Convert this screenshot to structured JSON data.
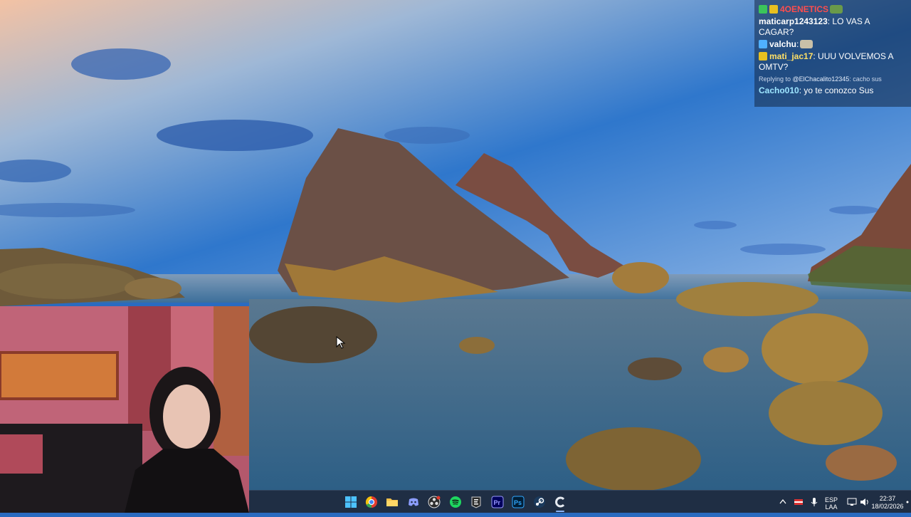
{
  "chat": {
    "messages": [
      {
        "user": "4OENETICS",
        "text": "",
        "user_color": "#ff4d4d",
        "badge_color": "#e8c020"
      },
      {
        "user": "maticarp1243123",
        "text": ": LO VAS A CAGAR?",
        "user_color": "#ffffff"
      },
      {
        "user": "valchu",
        "text": ":",
        "user_color": "#ffffff",
        "badge_color": "#4fb0ff"
      },
      {
        "user": "mati_jac17",
        "text": ": UUU VOLVEMOS A OMTV?",
        "user_color": "#ffe066",
        "badge_color": "#e8c020"
      },
      {
        "reply_prefix": "Replying to",
        "reply_target": "@ElChacalito12345",
        "reply_text": ": cacho sus"
      },
      {
        "user": "Cacho010",
        "text": ": yo te conozco Sus",
        "user_color": "#9ee6ff"
      }
    ]
  },
  "taskbar": {
    "pinned_apps": [
      "windows-start-icon",
      "chrome-icon",
      "file-explorer-icon",
      "discord-icon",
      "obs-icon",
      "spotify-icon",
      "epic-games-icon",
      "premiere-pro-icon",
      "photoshop-icon",
      "steam-icon",
      "app-icon"
    ],
    "tray": {
      "lang": "ESP",
      "layout": "LAA",
      "time": "22:37",
      "date": "18/02/2026"
    }
  },
  "colors": {
    "taskbar_bg": "#1f2e44",
    "chat_bg": "rgba(20,40,70,0.55)"
  }
}
